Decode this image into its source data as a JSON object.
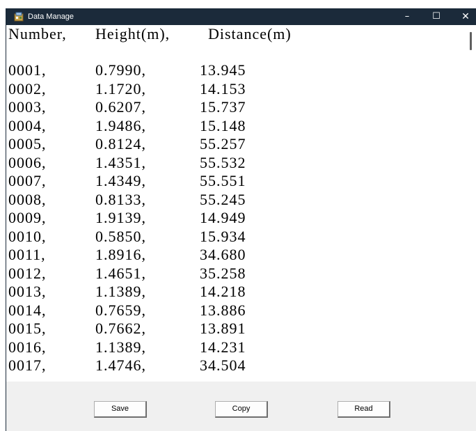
{
  "window": {
    "title": "Data Manage",
    "controls": {
      "minimize": "–",
      "maximize": "☐",
      "close": "✕"
    }
  },
  "table": {
    "headers": [
      "Number,",
      "Height(m),",
      "Distance(m)"
    ],
    "rows": [
      [
        "0001,",
        "0.7990,",
        "13.945"
      ],
      [
        "0002,",
        "1.1720,",
        "14.153"
      ],
      [
        "0003,",
        "0.6207,",
        "15.737"
      ],
      [
        "0004,",
        "1.9486,",
        "15.148"
      ],
      [
        "0005,",
        "0.8124,",
        "55.257"
      ],
      [
        "0006,",
        "1.4351,",
        "55.532"
      ],
      [
        "0007,",
        "1.4349,",
        "55.551"
      ],
      [
        "0008,",
        "0.8133,",
        "55.245"
      ],
      [
        "0009,",
        "1.9139,",
        "14.949"
      ],
      [
        "0010,",
        "0.5850,",
        "15.934"
      ],
      [
        "0011,",
        "1.8916,",
        "34.680"
      ],
      [
        "0012,",
        "1.4651,",
        "35.258"
      ],
      [
        "0013,",
        "1.1389,",
        "14.218"
      ],
      [
        "0014,",
        "0.7659,",
        "13.886"
      ],
      [
        "0015,",
        "0.7662,",
        "13.891"
      ],
      [
        "0016,",
        "1.1389,",
        "14.231"
      ],
      [
        "0017,",
        "1.4746,",
        "34.504"
      ]
    ]
  },
  "buttons": {
    "save": "Save",
    "copy": "Copy",
    "read": "Read"
  },
  "colors": {
    "titlebar": "#1b2a3a",
    "background": "#f0f0f0",
    "text_area": "#ffffff"
  },
  "icons": {
    "app": "app-window-icon"
  }
}
